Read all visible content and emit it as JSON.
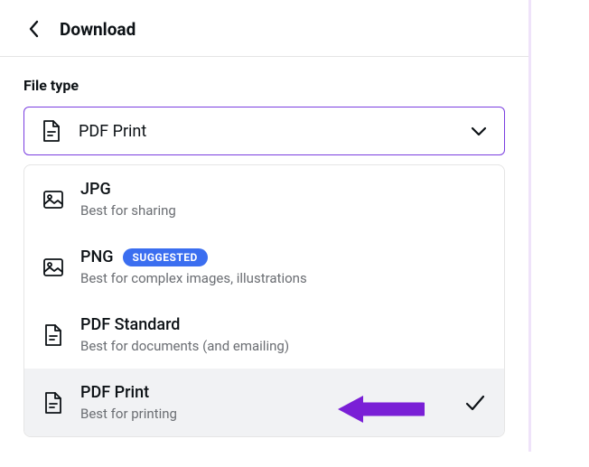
{
  "header": {
    "title": "Download"
  },
  "filetype": {
    "label": "File type",
    "selected": "PDF Print"
  },
  "options": [
    {
      "title": "JPG",
      "desc": "Best for sharing",
      "icon": "image",
      "badge": null,
      "selected": false
    },
    {
      "title": "PNG",
      "desc": "Best for complex images, illustrations",
      "icon": "image",
      "badge": "SUGGESTED",
      "selected": false
    },
    {
      "title": "PDF Standard",
      "desc": "Best for documents (and emailing)",
      "icon": "document",
      "badge": null,
      "selected": false
    },
    {
      "title": "PDF Print",
      "desc": "Best for printing",
      "icon": "document",
      "badge": null,
      "selected": true
    }
  ],
  "accent_color": "#7a3ee0",
  "badge_color": "#3b6ef0"
}
